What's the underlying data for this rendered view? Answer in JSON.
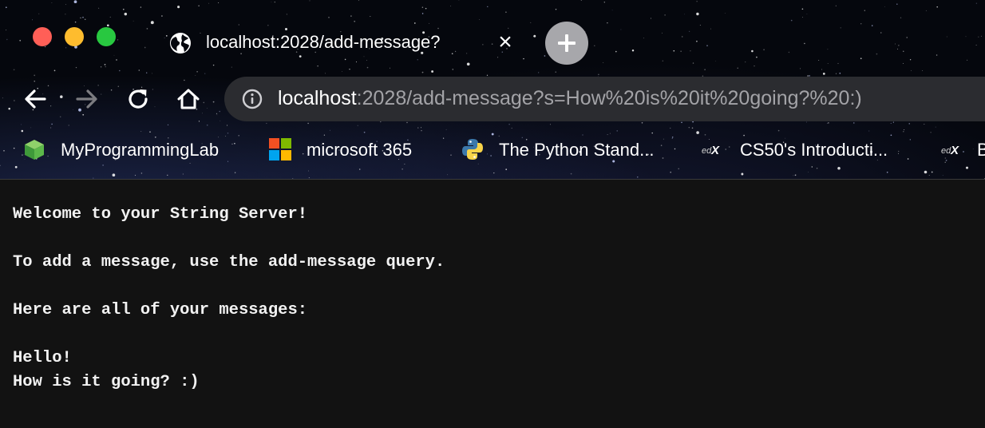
{
  "window": {
    "tab": {
      "title": "localhost:2028/add-message?",
      "close_glyph": "×",
      "icon": "globe-icon"
    },
    "new_tab_icon": "plus-icon",
    "colors": {
      "close": "#ff5f57",
      "minimize": "#febc2e",
      "maximize": "#28c840"
    }
  },
  "toolbar": {
    "back_icon": "back-arrow-icon",
    "forward_icon": "forward-arrow-icon",
    "reload_icon": "reload-icon",
    "home_icon": "home-icon",
    "address": {
      "host": "localhost",
      "rest": ":2028/add-message?s=How%20is%20it%20going?%20:)",
      "info_icon": "info-icon"
    }
  },
  "bookmarks": [
    {
      "label": "MyProgrammingLab",
      "icon": "green-cube-icon"
    },
    {
      "label": "microsoft 365",
      "icon": "microsoft-logo-icon"
    },
    {
      "label": "The Python Stand...",
      "icon": "python-logo-icon"
    },
    {
      "label": "CS50's Introducti...",
      "icon": "edx-logo-icon"
    },
    {
      "label": "B",
      "icon": "edx-logo-icon"
    }
  ],
  "page": {
    "welcome": "Welcome to your String Server!",
    "instructions": "To add a message, use the add-message query.",
    "messages_heading": "Here are all of your messages:",
    "messages": [
      "Hello!",
      "How is it going? :)"
    ]
  }
}
